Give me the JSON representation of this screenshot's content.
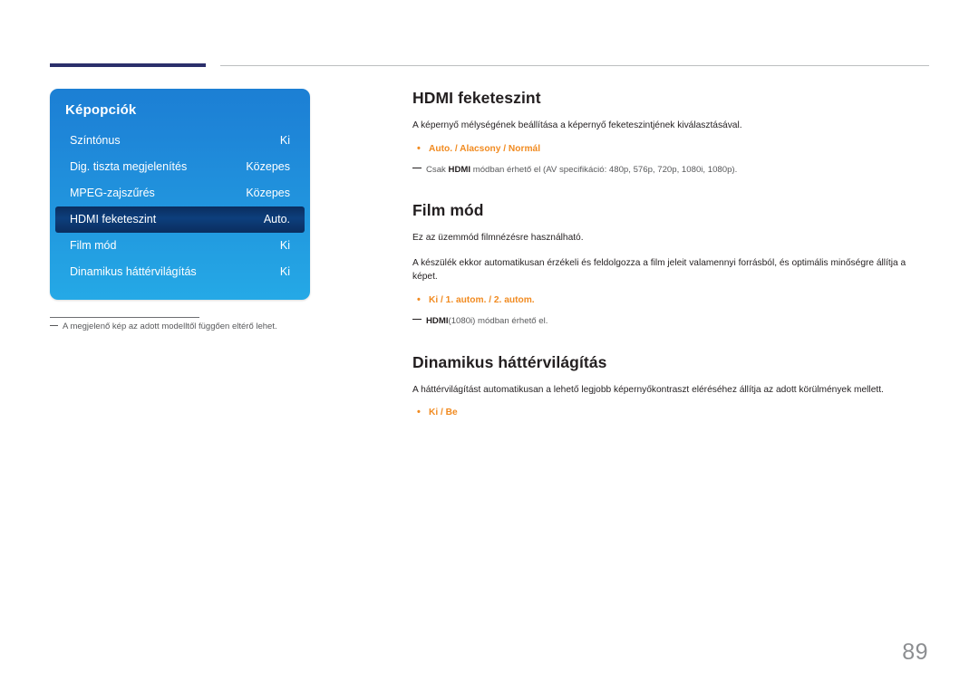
{
  "menu": {
    "title": "Képopciók",
    "rows": [
      {
        "label": "Színtónus",
        "value": "Ki",
        "selected": false
      },
      {
        "label": "Dig. tiszta megjelenítés",
        "value": "Közepes",
        "selected": false
      },
      {
        "label": "MPEG-zajszűrés",
        "value": "Közepes",
        "selected": false
      },
      {
        "label": "HDMI feketeszint",
        "value": "Auto.",
        "selected": true
      },
      {
        "label": "Film mód",
        "value": "Ki",
        "selected": false
      },
      {
        "label": "Dinamikus háttérvilágítás",
        "value": "Ki",
        "selected": false
      }
    ],
    "footnote": "A megjelenő kép az adott modelltől függően eltérő lehet."
  },
  "sections": [
    {
      "title": "HDMI feketeszint",
      "body1": "A képernyő mélységének beállítása a képernyő feketeszintjének kiválasztásával.",
      "options": "Auto. / Alacsony / Normál",
      "note_prefix": "Csak ",
      "note_bold": "HDMI",
      "note_suffix": " módban érhető el (AV specifikáció: 480p, 576p, 720p, 1080i, 1080p)."
    },
    {
      "title": "Film mód",
      "body1": "Ez az üzemmód filmnézésre használható.",
      "body2": "A készülék ekkor automatikusan érzékeli és feldolgozza a film jeleit valamennyi forrásból, és optimális minőségre állítja a képet.",
      "options": "Ki / 1. autom. / 2. autom.",
      "note_prefix": "",
      "note_bold": "HDMI",
      "note_suffix": "(1080i) módban érhető el."
    },
    {
      "title": "Dinamikus háttérvilágítás",
      "body1": "A háttérvilágítást automatikusan a lehető legjobb képernyőkontraszt eléréséhez állítja az adott körülmények mellett.",
      "options": "Ki / Be"
    }
  ],
  "page_number": "89"
}
